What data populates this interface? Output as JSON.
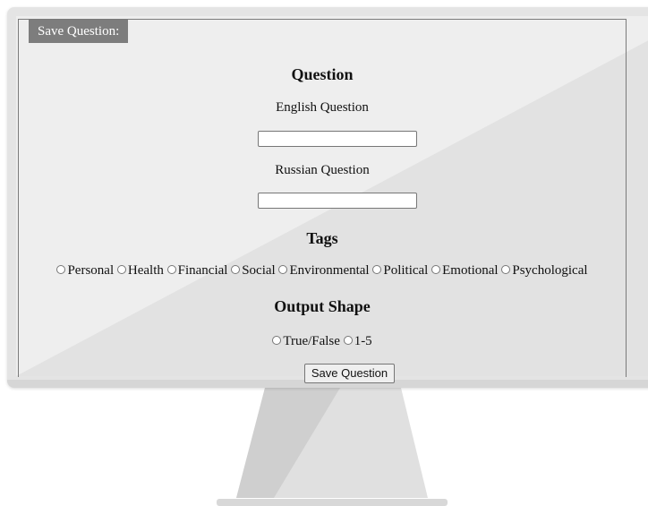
{
  "legend": "Save Question:",
  "question_heading": "Question",
  "english_label": "English Question",
  "english_value": "",
  "russian_label": "Russian Question",
  "russian_value": "",
  "tags_heading": "Tags",
  "tags": [
    "Personal",
    "Health",
    "Financial",
    "Social",
    "Environmental",
    "Political",
    "Emotional",
    "Psychological"
  ],
  "output_heading": "Output Shape",
  "output_options": [
    "True/False",
    "1-5"
  ],
  "submit_label": "Save Question"
}
